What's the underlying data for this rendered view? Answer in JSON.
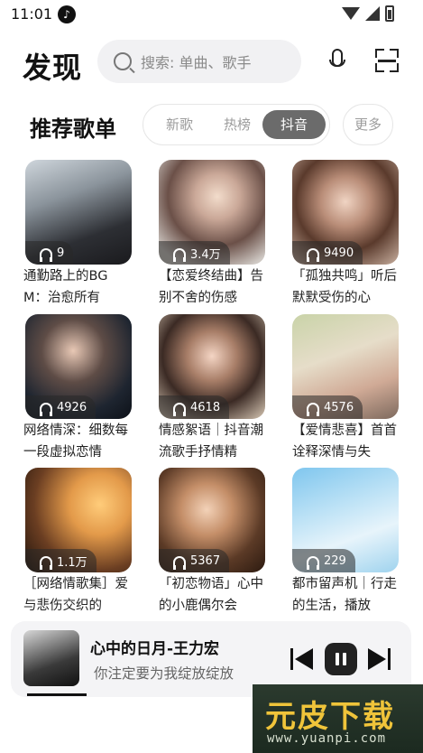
{
  "status_bar": {
    "time": "11:01"
  },
  "header": {
    "brand": "发现",
    "search_placeholder": "搜索: 单曲、歌手"
  },
  "section": {
    "title": "推荐歌单",
    "tabs": [
      {
        "label": "新歌",
        "active": false
      },
      {
        "label": "热榜",
        "active": false
      },
      {
        "label": "抖音",
        "active": true
      }
    ],
    "more": "更多"
  },
  "playlists": [
    {
      "count": "9",
      "title": "通勤路上的BGM：治愈所有"
    },
    {
      "count": "3.4万",
      "title": "【恋爱终结曲】告别不舍的伤感"
    },
    {
      "count": "9490",
      "title": "「孤独共鸣」听后默默受伤的心"
    },
    {
      "count": "4926",
      "title": "网络情深：细数每一段虚拟恋情"
    },
    {
      "count": "4618",
      "title": "情感絮语｜抖音潮流歌手抒情精"
    },
    {
      "count": "4576",
      "title": "【爱情悲喜】首首诠释深情与失"
    },
    {
      "count": "1.1万",
      "title": "［网络情歌集］爱与悲伤交织的"
    },
    {
      "count": "5367",
      "title": "「初恋物语」心中的小鹿偶尔会"
    },
    {
      "count": "229",
      "title": "都市留声机｜行走的生活，播放"
    }
  ],
  "player": {
    "title": "心中的日月-王力宏",
    "lyric": "你注定要为我绽放绽放"
  },
  "watermark": {
    "main": "元皮下载",
    "sub": "www.yuanpi.com"
  }
}
